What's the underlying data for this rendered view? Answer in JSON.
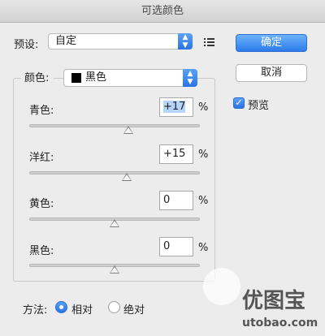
{
  "window": {
    "title": "可选颜色"
  },
  "preset": {
    "label": "预设:",
    "value": "自定"
  },
  "buttons": {
    "ok": "确定",
    "cancel": "取消"
  },
  "preview": {
    "label": "预览",
    "checked": true
  },
  "colors": {
    "label": "颜色:",
    "value": "黑色",
    "swatch": "#000000"
  },
  "sliders": [
    {
      "label": "青色:",
      "value": "+17",
      "unit": "%",
      "level_percent": 58.5
    },
    {
      "label": "洋红:",
      "value": "+15",
      "unit": "%",
      "level_percent": 57.5
    },
    {
      "label": "黄色:",
      "value": "0",
      "unit": "%",
      "level_percent": 50
    },
    {
      "label": "黑色:",
      "value": "0",
      "unit": "%",
      "level_percent": 50
    }
  ],
  "method": {
    "label": "方法:",
    "options": [
      "相对",
      "绝对"
    ],
    "selected": "相对"
  },
  "watermark": {
    "brand_cn": "优图宝",
    "url": "utobao.com"
  }
}
